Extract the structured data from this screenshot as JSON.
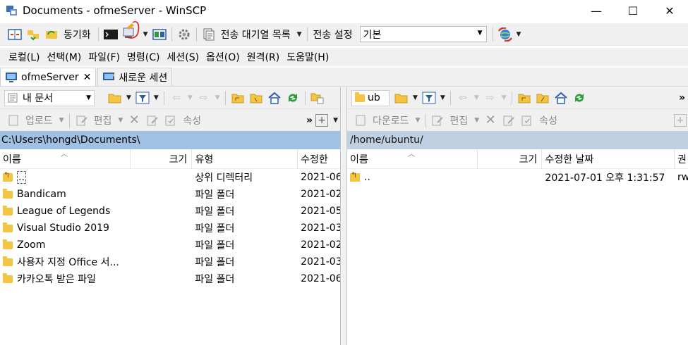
{
  "window": {
    "title": "Documents - ofmeServer - WinSCP",
    "minimize_glyph": "—",
    "maximize_glyph": "☐",
    "close_glyph": "✕"
  },
  "toolbar": {
    "sync_label": "동기화",
    "queue_label": "전송 대기열 목록",
    "transfer_settings_label": "전송 설정",
    "preset_value": "기본"
  },
  "menu": [
    "로컬(L)",
    "선택(M)",
    "파일(F)",
    "명령(C)",
    "세션(S)",
    "옵션(O)",
    "원격(R)",
    "도움말(H)"
  ],
  "tabs": [
    {
      "label": "ofmeServer",
      "close": "✕"
    },
    {
      "label": "새로운 세션"
    }
  ],
  "left_panel": {
    "location": "내 문서",
    "upload_label": "업로드",
    "edit_label": "편집",
    "props_label": "속성",
    "path": "C:\\Users\\hongd\\Documents\\",
    "columns": {
      "name": "이름",
      "size": "크기",
      "type": "유형",
      "modified": "수정한"
    },
    "rows": [
      {
        "name": "..",
        "size": "",
        "type": "상위 디렉터리",
        "modified": "2021-06",
        "kind": "updir"
      },
      {
        "name": "Bandicam",
        "size": "",
        "type": "파일 폴더",
        "modified": "2021-02",
        "kind": "folder"
      },
      {
        "name": "League of Legends",
        "size": "",
        "type": "파일 폴더",
        "modified": "2021-05",
        "kind": "folder"
      },
      {
        "name": "Visual Studio 2019",
        "size": "",
        "type": "파일 폴더",
        "modified": "2021-03",
        "kind": "folder"
      },
      {
        "name": "Zoom",
        "size": "",
        "type": "파일 폴더",
        "modified": "2021-02",
        "kind": "folder"
      },
      {
        "name": "사용자 지정 Office 서...",
        "size": "",
        "type": "파일 폴더",
        "modified": "2021-03",
        "kind": "folder"
      },
      {
        "name": "카카오톡 받은 파일",
        "size": "",
        "type": "파일 폴더",
        "modified": "2021-06",
        "kind": "folder"
      }
    ]
  },
  "right_panel": {
    "location": "ub",
    "download_label": "다운로드",
    "edit_label": "편집",
    "props_label": "속성",
    "path": "/home/ubuntu/",
    "columns": {
      "name": "이름",
      "size": "크기",
      "modified": "수정한 날짜",
      "rights": "권"
    },
    "rows": [
      {
        "name": "..",
        "size": "",
        "modified": "2021-07-01 오후 1:31:57",
        "rights": "rw",
        "kind": "updir"
      }
    ]
  },
  "colors": {
    "active_path": "#a0c1e2",
    "inactive_path": "#bfd0e2",
    "annotation": "#e0201a"
  }
}
